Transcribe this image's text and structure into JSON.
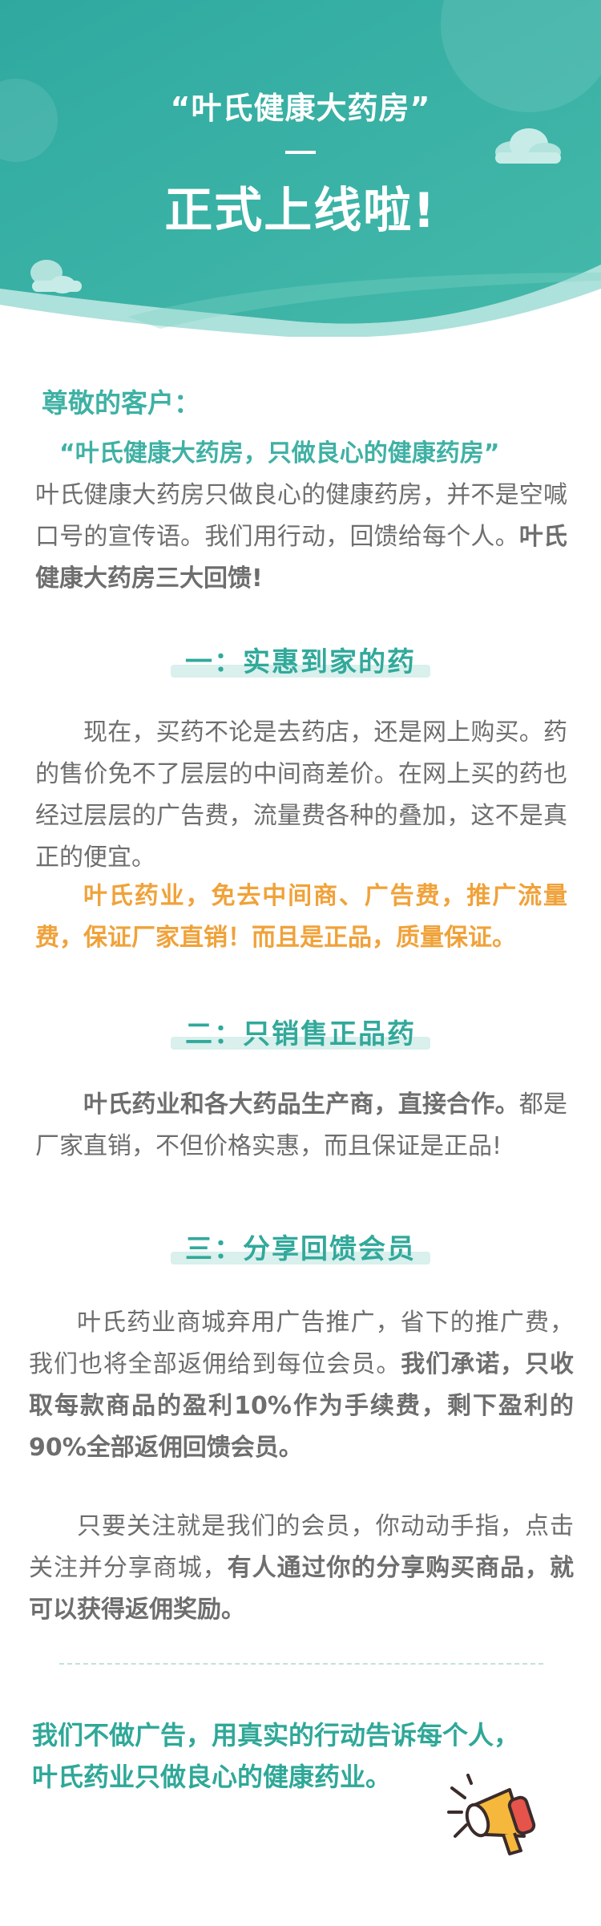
{
  "header": {
    "line1": "“叶氏健康大药房”",
    "dash": "—",
    "line2": "正式上线啦!"
  },
  "greeting": "尊敬的客户：",
  "intro": {
    "slogan": "“叶氏健康大药房，只做良心的健康药房”",
    "text": "叶氏健康大药房只做良心的健康药房，并不是空喊口号的宣传语。我们用行动，回馈给每个人。",
    "bold": "叶氏健康大药房三大回馈!"
  },
  "section1": {
    "title": "一：实惠到家的药",
    "text": "现在，买药不论是去药店，还是网上购买。药的售价免不了层层的中间商差价。在网上买的药也经过层层的广告费，流量费各种的叠加，这不是真正的便宜。",
    "highlight": "叶氏药业，免去中间商、广告费，推广流量费，保证厂家直销！而且是正品，质量保证。"
  },
  "section2": {
    "title": "二：只销售正品药",
    "bold": "叶氏药业和各大药品生产商，直接合作。",
    "text": "都是厂家直销，不但价格实惠，而且保证是正品!"
  },
  "section3": {
    "title": "三：分享回馈会员",
    "text1": "叶氏药业商城弃用广告推广，省下的推广费，我们也将全部返佣给到每位会员。",
    "bold1": "我们承诺，只收取每款商品的盈利10%作为手续费，剩下盈利的90%全部返佣回馈会员。",
    "text2": "只要关注就是我们的会员，你动动手指，点击关注并分享商城，",
    "bold2": "有人通过你的分享购买商品，就可以获得返佣奖励。"
  },
  "closing": {
    "line1": "我们不做广告，用真实的行动告诉每个人，",
    "line2": "叶氏药业只做良心的健康药业。"
  },
  "colors": {
    "teal": "#3fb1a4",
    "orange": "#f0a23a",
    "text": "#6e6e6e"
  },
  "icons": [
    "cloud-icon",
    "megaphone-icon"
  ]
}
